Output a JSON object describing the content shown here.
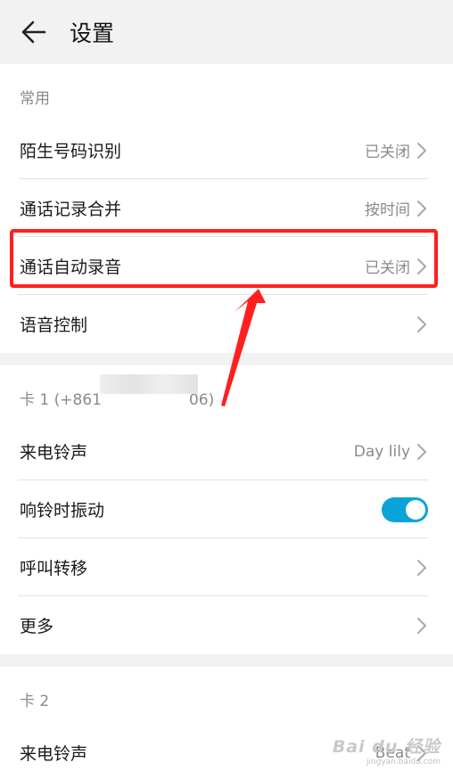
{
  "header": {
    "title": "设置"
  },
  "common": {
    "section_label": "常用",
    "items": [
      {
        "label": "陌生号码识别",
        "value": "已关闭"
      },
      {
        "label": "通话记录合并",
        "value": "按时间"
      },
      {
        "label": "通话自动录音",
        "value": "已关闭"
      },
      {
        "label": "语音控制",
        "value": ""
      }
    ]
  },
  "card1": {
    "section_label": "卡 1 (+861",
    "masked_tail": "06)",
    "items": [
      {
        "label": "来电铃声",
        "value": "Day lily"
      },
      {
        "label": "响铃时振动",
        "toggle_on": true
      },
      {
        "label": "呼叫转移",
        "value": ""
      },
      {
        "label": "更多",
        "value": ""
      }
    ]
  },
  "card2": {
    "section_label": "卡 2",
    "items": [
      {
        "label": "来电铃声",
        "value": "Beat"
      }
    ]
  },
  "watermark": {
    "main": "Bai du 经验",
    "sub": "jingyan.baidu.com"
  },
  "colors": {
    "accent": "#0aa3d9",
    "annotation": "#ff1f1f",
    "background": "#f2f2f2"
  }
}
